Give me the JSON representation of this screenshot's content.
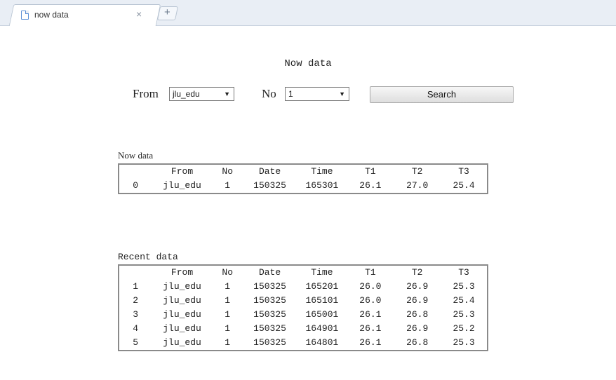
{
  "browser": {
    "tab_title": "now data",
    "tab_close": "×",
    "new_tab": "+"
  },
  "page": {
    "title": "Now data",
    "from_label": "From",
    "from_value": "jlu_edu",
    "no_label": "No",
    "no_value": "1",
    "search_label": "Search"
  },
  "now_table": {
    "caption": "Now data",
    "headers": [
      "",
      "From",
      "No",
      "Date",
      "Time",
      "T1",
      "T2",
      "T3"
    ],
    "rows": [
      [
        "0",
        "jlu_edu",
        "1",
        "150325",
        "165301",
        "26.1",
        "27.0",
        "25.4"
      ]
    ]
  },
  "recent_table": {
    "caption": "Recent data",
    "headers": [
      "",
      "From",
      "No",
      "Date",
      "Time",
      "T1",
      "T2",
      "T3"
    ],
    "rows": [
      [
        "1",
        "jlu_edu",
        "1",
        "150325",
        "165201",
        "26.0",
        "26.9",
        "25.3"
      ],
      [
        "2",
        "jlu_edu",
        "1",
        "150325",
        "165101",
        "26.0",
        "26.9",
        "25.4"
      ],
      [
        "3",
        "jlu_edu",
        "1",
        "150325",
        "165001",
        "26.1",
        "26.8",
        "25.3"
      ],
      [
        "4",
        "jlu_edu",
        "1",
        "150325",
        "164901",
        "26.1",
        "26.9",
        "25.2"
      ],
      [
        "5",
        "jlu_edu",
        "1",
        "150325",
        "164801",
        "26.1",
        "26.8",
        "25.3"
      ]
    ]
  }
}
